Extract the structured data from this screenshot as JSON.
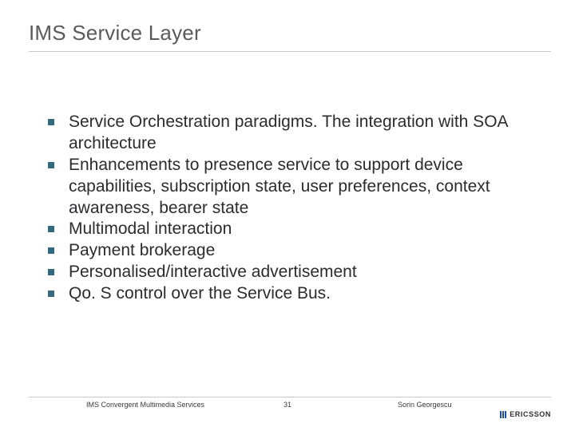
{
  "title": "IMS Service Layer",
  "bullets": [
    "Service Orchestration paradigms. The integration with SOA architecture",
    "Enhancements to presence service to support device capabilities, subscription state, user preferences, context awareness, bearer state",
    "Multimodal interaction",
    "Payment brokerage",
    "Personalised/interactive advertisement",
    "Qo. S control over the Service Bus."
  ],
  "footer": {
    "doc_title": "IMS Convergent Multimedia Services",
    "page_number": "31",
    "author": "Sorin Georgescu",
    "logo_text": "ERICSSON"
  }
}
